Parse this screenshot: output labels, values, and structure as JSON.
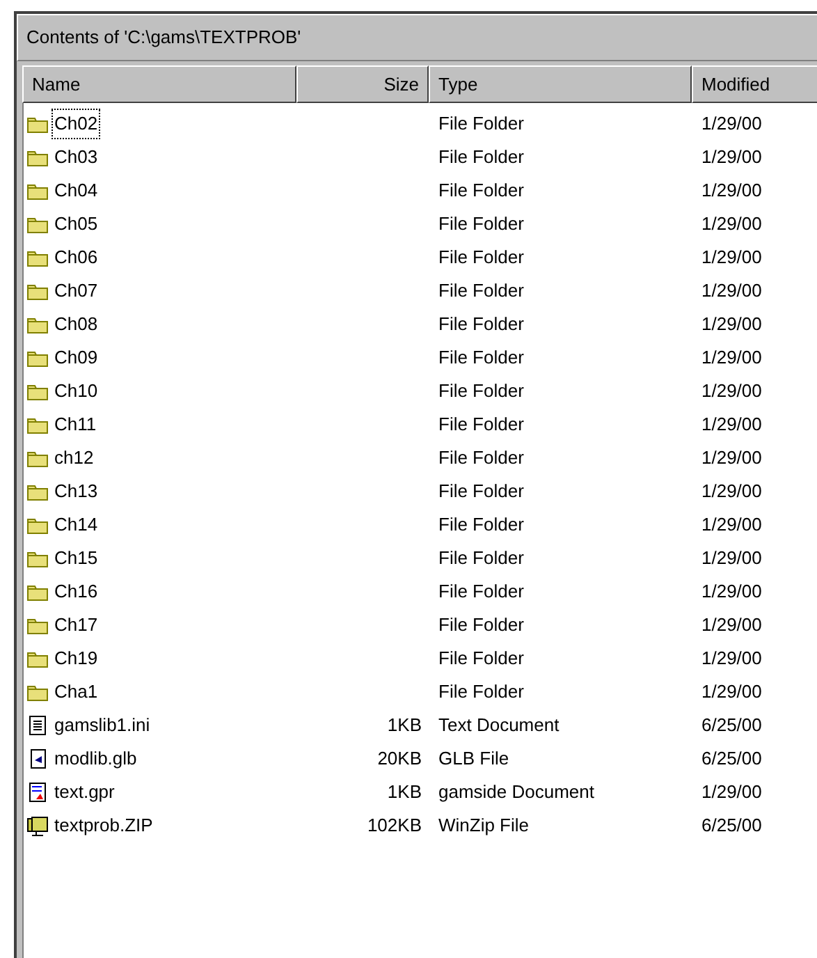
{
  "panel": {
    "title": "Contents of 'C:\\gams\\TEXTPROB'"
  },
  "columns": [
    {
      "label": "Name"
    },
    {
      "label": "Size"
    },
    {
      "label": "Type"
    },
    {
      "label": "Modified"
    }
  ],
  "rows": [
    {
      "kind": "folder",
      "name": "Ch02",
      "size": "",
      "type": "File Folder",
      "modified": "1/29/00",
      "focused": true
    },
    {
      "kind": "folder",
      "name": "Ch03",
      "size": "",
      "type": "File Folder",
      "modified": "1/29/00",
      "focused": false
    },
    {
      "kind": "folder",
      "name": "Ch04",
      "size": "",
      "type": "File Folder",
      "modified": "1/29/00",
      "focused": false
    },
    {
      "kind": "folder",
      "name": "Ch05",
      "size": "",
      "type": "File Folder",
      "modified": "1/29/00",
      "focused": false
    },
    {
      "kind": "folder",
      "name": "Ch06",
      "size": "",
      "type": "File Folder",
      "modified": "1/29/00",
      "focused": false
    },
    {
      "kind": "folder",
      "name": "Ch07",
      "size": "",
      "type": "File Folder",
      "modified": "1/29/00",
      "focused": false
    },
    {
      "kind": "folder",
      "name": "Ch08",
      "size": "",
      "type": "File Folder",
      "modified": "1/29/00",
      "focused": false
    },
    {
      "kind": "folder",
      "name": "Ch09",
      "size": "",
      "type": "File Folder",
      "modified": "1/29/00",
      "focused": false
    },
    {
      "kind": "folder",
      "name": "Ch10",
      "size": "",
      "type": "File Folder",
      "modified": "1/29/00",
      "focused": false
    },
    {
      "kind": "folder",
      "name": "Ch11",
      "size": "",
      "type": "File Folder",
      "modified": "1/29/00",
      "focused": false
    },
    {
      "kind": "folder",
      "name": "ch12",
      "size": "",
      "type": "File Folder",
      "modified": "1/29/00",
      "focused": false
    },
    {
      "kind": "folder",
      "name": "Ch13",
      "size": "",
      "type": "File Folder",
      "modified": "1/29/00",
      "focused": false
    },
    {
      "kind": "folder",
      "name": "Ch14",
      "size": "",
      "type": "File Folder",
      "modified": "1/29/00",
      "focused": false
    },
    {
      "kind": "folder",
      "name": "Ch15",
      "size": "",
      "type": "File Folder",
      "modified": "1/29/00",
      "focused": false
    },
    {
      "kind": "folder",
      "name": "Ch16",
      "size": "",
      "type": "File Folder",
      "modified": "1/29/00",
      "focused": false
    },
    {
      "kind": "folder",
      "name": "Ch17",
      "size": "",
      "type": "File Folder",
      "modified": "1/29/00",
      "focused": false
    },
    {
      "kind": "folder",
      "name": "Ch19",
      "size": "",
      "type": "File Folder",
      "modified": "1/29/00",
      "focused": false
    },
    {
      "kind": "folder",
      "name": "Cha1",
      "size": "",
      "type": "File Folder",
      "modified": "1/29/00",
      "focused": false
    },
    {
      "kind": "text",
      "name": "gamslib1.ini",
      "size": "1KB",
      "type": "Text Document",
      "modified": "6/25/00",
      "focused": false
    },
    {
      "kind": "glb",
      "name": "modlib.glb",
      "size": "20KB",
      "type": "GLB File",
      "modified": "6/25/00",
      "focused": false
    },
    {
      "kind": "gpr",
      "name": "text.gpr",
      "size": "1KB",
      "type": "gamside Document",
      "modified": "1/29/00",
      "focused": false
    },
    {
      "kind": "zip",
      "name": "textprob.ZIP",
      "size": "102KB",
      "type": "WinZip File",
      "modified": "6/25/00",
      "focused": false
    }
  ]
}
